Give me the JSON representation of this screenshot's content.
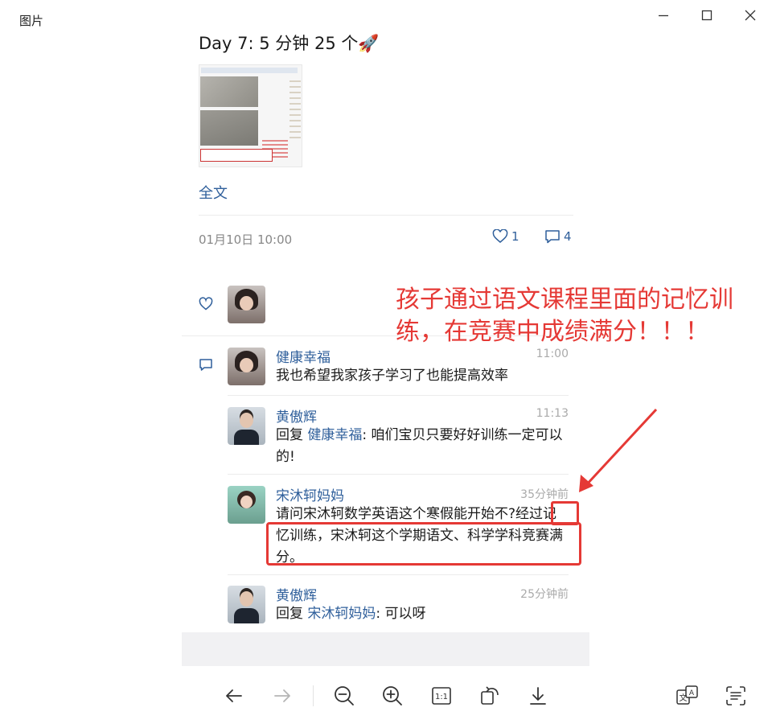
{
  "window": {
    "title": "图片",
    "controls": [
      "minimize-icon",
      "maximize-icon",
      "close-icon"
    ]
  },
  "post": {
    "title": "Day 7:  5 分钟 25 个🚀",
    "full_text_link": "全文",
    "timestamp": "01月10日 10:00",
    "like_count": "1",
    "comment_count": "4"
  },
  "comments": [
    {
      "name": "健康幸福",
      "time": "11:00",
      "text": "我也希望我家孩子学习了也能提高效率",
      "avatar": "woman"
    },
    {
      "name": "黄傲辉",
      "time": "11:13",
      "reply_prefix": "回复 ",
      "reply_to": "健康幸福",
      "text": ": 咱们宝贝只要好好训练一定可以的!",
      "avatar": "man"
    },
    {
      "name": "宋沐轲妈妈",
      "time": "35分钟前",
      "text": "请问宋沐轲数学英语这个寒假能开始不?经过记忆训练，宋沐轲这个学期语文、科学学科竞赛满分。",
      "avatar": "girl"
    },
    {
      "name": "黄傲辉",
      "time": "25分钟前",
      "reply_prefix": "回复 ",
      "reply_to": "宋沐轲妈妈",
      "text": ": 可以呀",
      "avatar": "man"
    }
  ],
  "annotation": {
    "text": "孩子通过语文课程里面的记忆训练，在竞赛中成绩满分！！！",
    "color": "#e53935"
  },
  "toolbar": {
    "buttons": [
      "back-arrow-icon",
      "forward-arrow-icon",
      "zoom-out-icon",
      "zoom-in-icon",
      "actual-size-icon",
      "rotate-icon",
      "download-icon",
      "translate-icon",
      "ocr-icon"
    ],
    "actual_size_label": "1:1"
  },
  "colors": {
    "link": "#2f5f9b",
    "annotation": "#e53935",
    "muted": "#888888"
  }
}
